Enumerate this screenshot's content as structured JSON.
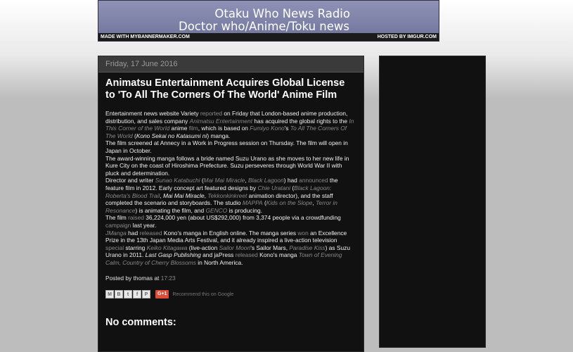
{
  "banner": {
    "line1": "Otaku Who News Radio",
    "line2": "Doctor who/Anime/Toku news",
    "made_with": "MADE WITH MYBANNERMAKER.COM",
    "hosted_by": "HOSTED BY IMGUR.COM"
  },
  "post": {
    "date": "Friday, 17 June 2016",
    "title": "Animatsu Entertainment Acquires Global License to 'To All The Corners Of The World' Anime Film",
    "body": {
      "p1_a": "Entertainment news website Variety ",
      "p1_link_reported": "reported",
      "p1_b": " on Friday that London-based anime production, distribution, and sales company ",
      "p1_link_animatsu": "Animatsu Entertainment",
      "p1_c": " has acquired the global rights to the ",
      "p1_link_corner": "In This Corner of the World",
      "p1_d": " anime ",
      "p1_link_film": "film",
      "p1_e": ", which is based on ",
      "p1_link_fumiyo": "Fumiyo Kono",
      "p1_f": "'s ",
      "p1_link_corners": "To All The Corners Of The World",
      "p1_g": " (",
      "p1_kono_title": "Kono Sekai no Katasumi ni",
      "p1_h": ") manga.",
      "p2": "The film screened at Annecy in a Work in Progress session on Thursday. The film will open in Japan in October.",
      "p3": "The award-winning manga follows a bride named Suzu Urano as she moves to her new life in Kure City on the coast of Hiroshima Prefecture. Suzu perseveres through World War II with pluck and determination.",
      "p4_a": "Director and writer ",
      "p4_link_sunao": "Sunao Katabuchi",
      "p4_b": " (",
      "p4_link_maimai": "Mai Mai Miracle",
      "p4_c": ", ",
      "p4_link_lagoon": "Black Lagoon",
      "p4_d": ") had ",
      "p4_link_announced": "announced",
      "p4_e": " the feature film in 2012. Early concept art featured designs by ",
      "p4_link_chie": "Chie Uratani",
      "p4_f": " (",
      "p4_link_roberta": "Black Lagoon: Roberta's Blood Trail",
      "p4_g": ", ",
      "p4_maimai2": "Mai Mai Miracle",
      "p4_h": ", ",
      "p4_link_tekkon": "Tekkonkinkreet",
      "p4_i": " animation director), and the staff completed the scenario and storyboards. The studio ",
      "p4_link_mappa": "MAPPA",
      "p4_j": " (",
      "p4_link_kids": "Kids on the Slope",
      "p4_k": ", ",
      "p4_link_terror": "Terror in Resonance",
      "p4_l": ") is animating the film, and ",
      "p4_link_genco": "GENCO",
      "p4_m": " is producing.",
      "p5_a": "The film ",
      "p5_link_raised": "raised",
      "p5_b": " 36,224,000 yen (about US$292,000) from 3,374 people via a crowdfunding ",
      "p5_link_campaign": "campaign",
      "p5_c": " last year.",
      "p6_link_jmanga": "JManga",
      "p6_a": " had ",
      "p6_link_released": "released",
      "p6_b": " Kono's manga in English online. The manga series ",
      "p6_link_won": "won",
      "p6_c": " an Excellence Prize in the 13th Japan Media Arts Festival, and it already inspired a live-action television ",
      "p6_link_special": "special",
      "p6_d": " starring ",
      "p6_link_keiko": "Keiko Kitagawa",
      "p6_e": " (live-action ",
      "p6_link_sailormoon": "Sailor Moon",
      "p6_f": "'s Sailor Mars, ",
      "p6_link_paradise": "Paradise Kiss",
      "p6_g": ") as Suzu Urano in 2011. ",
      "p6_lastgasp": "Last Gasp Publishing",
      "p6_h": " and jaPress ",
      "p6_link_released2": "released",
      "p6_i": " Kono's manga ",
      "p6_link_town": "Town of Evening Calm, Country of Cherry Blossoms",
      "p6_j": " in North America."
    },
    "posted_by_label": "Posted by",
    "author": "thomas",
    "at_label": "at",
    "time": "17:23",
    "share": [
      "M",
      "B",
      "t",
      "f",
      "P"
    ],
    "gplus_label": "G+1",
    "recommend_text": "Recommend this on Google",
    "comments_title": "No comments:"
  },
  "colors": {
    "link": "#8a8a8a",
    "post_bg": "#111111",
    "page_bg": "#bdbdbd"
  }
}
